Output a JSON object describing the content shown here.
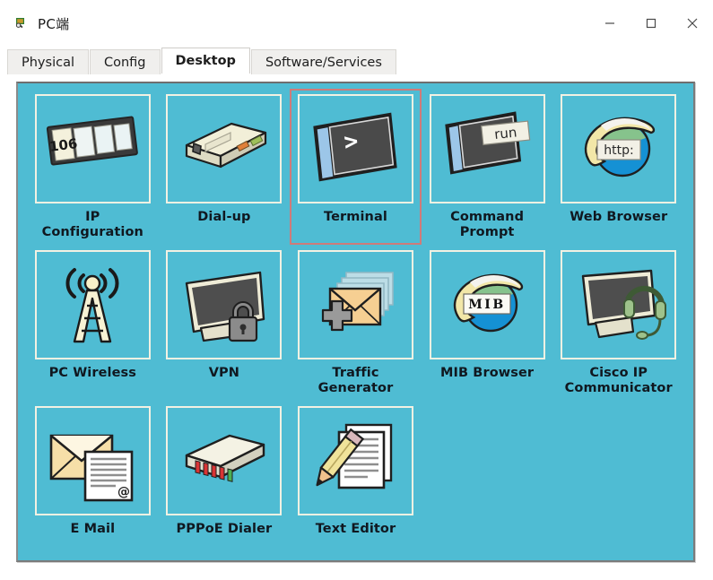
{
  "window": {
    "title": "PC端",
    "icon": "packet-tracer-pc-icon",
    "controls": {
      "minimize_label": "─",
      "maximize_label": "□",
      "close_label": "✕"
    }
  },
  "tabs": [
    {
      "label": "Physical",
      "active": false
    },
    {
      "label": "Config",
      "active": false
    },
    {
      "label": "Desktop",
      "active": true
    },
    {
      "label": "Software/Services",
      "active": false
    }
  ],
  "colors": {
    "desktop_background": "#4fbcd3",
    "icon_box_border": "#f2f1e3",
    "selection_border": "#cf7b79",
    "panel_border": "#7b7b7b",
    "label_text": "#101820",
    "active_tab_background": "#ffffff",
    "inactive_tab_background": "#f0efed"
  },
  "desktop": {
    "items": [
      {
        "label_line1": "IP",
        "label_line2": "Configuration",
        "icon": "ip-configuration-icon",
        "icon_text": "106",
        "selected": false
      },
      {
        "label_line1": "Dial-up",
        "label_line2": "",
        "icon": "dial-up-modem-icon",
        "icon_text": "",
        "selected": false
      },
      {
        "label_line1": "Terminal",
        "label_line2": "",
        "icon": "terminal-icon",
        "icon_text": ">",
        "selected": true
      },
      {
        "label_line1": "Command",
        "label_line2": "Prompt",
        "icon": "command-prompt-icon",
        "icon_text": "run",
        "selected": false
      },
      {
        "label_line1": "Web Browser",
        "label_line2": "",
        "icon": "web-browser-icon",
        "icon_text": "http:",
        "selected": false
      },
      {
        "label_line1": "PC Wireless",
        "label_line2": "",
        "icon": "pc-wireless-antenna-icon",
        "icon_text": "",
        "selected": false
      },
      {
        "label_line1": "VPN",
        "label_line2": "",
        "icon": "vpn-monitor-lock-icon",
        "icon_text": "",
        "selected": false
      },
      {
        "label_line1": "Traffic",
        "label_line2": "Generator",
        "icon": "traffic-generator-icon",
        "icon_text": "",
        "selected": false
      },
      {
        "label_line1": "MIB Browser",
        "label_line2": "",
        "icon": "mib-browser-icon",
        "icon_text": "MIB",
        "selected": false
      },
      {
        "label_line1": "Cisco IP",
        "label_line2": "Communicator",
        "icon": "cisco-ip-communicator-icon",
        "icon_text": "",
        "selected": false
      },
      {
        "label_line1": "E Mail",
        "label_line2": "",
        "icon": "email-icon",
        "icon_text": "@",
        "selected": false
      },
      {
        "label_line1": "PPPoE Dialer",
        "label_line2": "",
        "icon": "pppoe-dialer-icon",
        "icon_text": "",
        "selected": false
      },
      {
        "label_line1": "Text Editor",
        "label_line2": "",
        "icon": "text-editor-icon",
        "icon_text": "",
        "selected": false
      }
    ]
  }
}
